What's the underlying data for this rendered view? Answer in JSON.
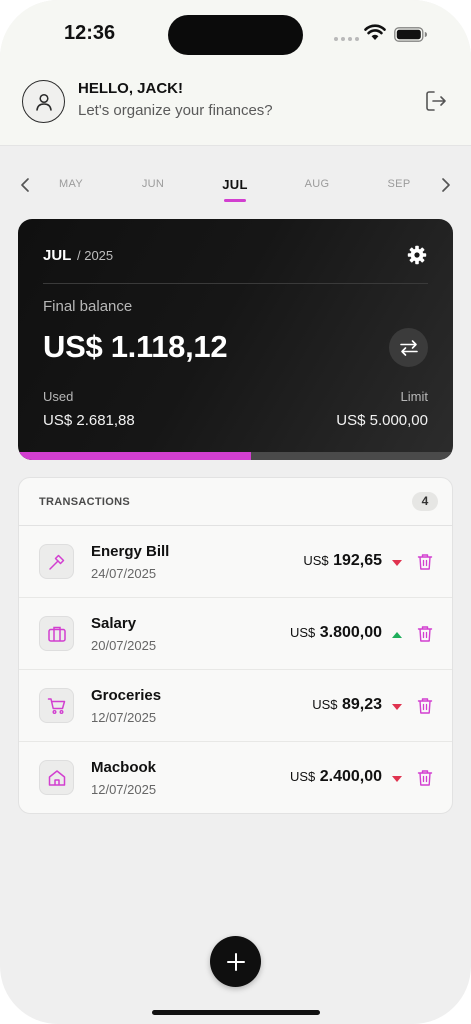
{
  "status_bar": {
    "time": "12:36"
  },
  "header": {
    "greeting": "HELLO, JACK!",
    "subtitle": "Let's organize your finances?",
    "avatar_icon": "user-icon",
    "logout_icon": "logout-icon"
  },
  "months": {
    "items": [
      {
        "label": "MAY",
        "active": false
      },
      {
        "label": "JUN",
        "active": false
      },
      {
        "label": "JUL",
        "active": true
      },
      {
        "label": "AUG",
        "active": false
      },
      {
        "label": "SEP",
        "active": false
      }
    ]
  },
  "balance_card": {
    "month": "JUL",
    "year": "/ 2025",
    "final_label": "Final balance",
    "final_value": "US$ 1.118,12",
    "used_label": "Used",
    "used_value": "US$ 2.681,88",
    "limit_label": "Limit",
    "limit_value": "US$ 5.000,00",
    "usage_fraction": 0.536
  },
  "transactions": {
    "title": "TRANSACTIONS",
    "count": "4",
    "items": [
      {
        "name": "Energy Bill",
        "date": "24/07/2025",
        "currency": "US$",
        "amount": "192,65",
        "trend": "down",
        "icon": "hammer-icon"
      },
      {
        "name": "Salary",
        "date": "20/07/2025",
        "currency": "US$",
        "amount": "3.800,00",
        "trend": "up",
        "icon": "briefcase-icon"
      },
      {
        "name": "Groceries",
        "date": "12/07/2025",
        "currency": "US$",
        "amount": "89,23",
        "trend": "down",
        "icon": "cart-icon"
      },
      {
        "name": "Macbook",
        "date": "12/07/2025",
        "currency": "US$",
        "amount": "2.400,00",
        "trend": "down",
        "icon": "home-icon"
      }
    ]
  },
  "colors": {
    "accent": "#d23fd0",
    "down": "#e0334f",
    "up": "#1fae5b",
    "card_bg": "#151515"
  }
}
